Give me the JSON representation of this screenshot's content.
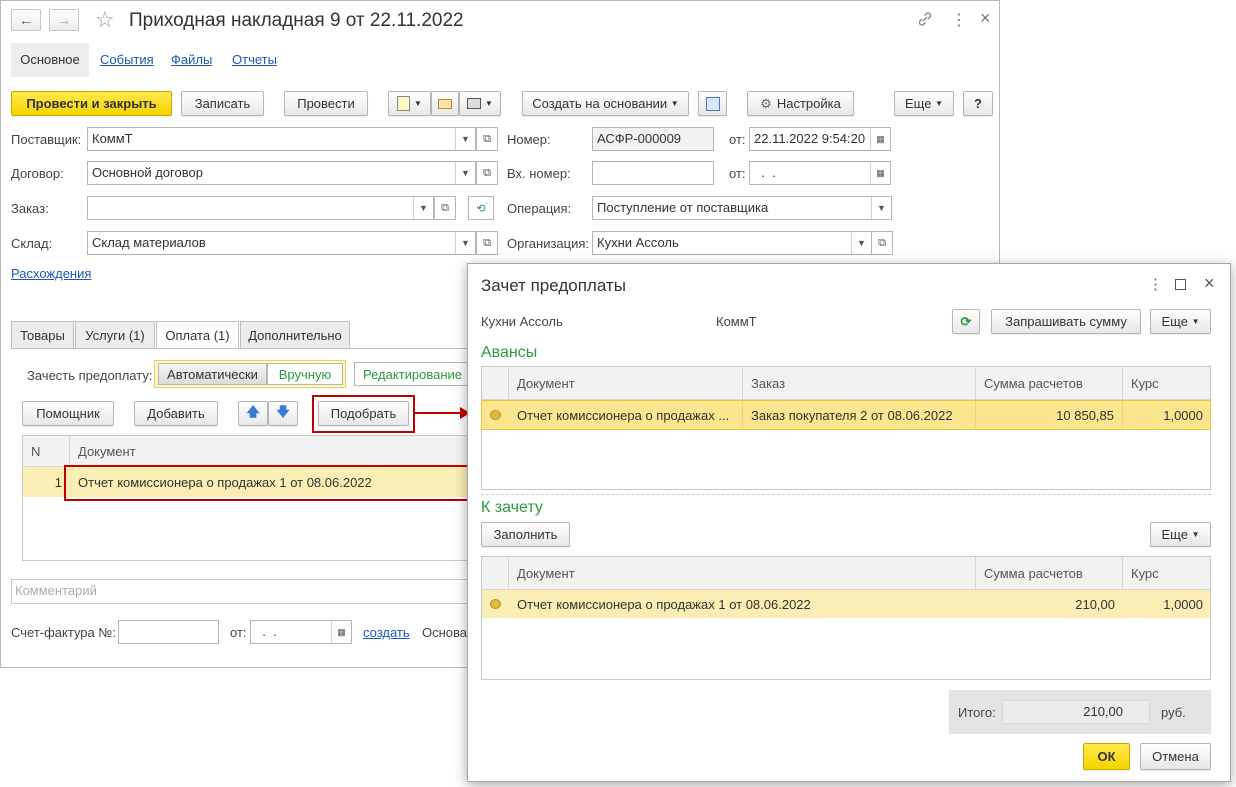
{
  "main": {
    "title": "Приходная накладная 9 от 22.11.2022",
    "nav_back": "←",
    "nav_forward": "→",
    "star": "☆",
    "link_icon": "🔗",
    "more_icon": "⋮",
    "close_icon": "×",
    "tabs": [
      "Основное",
      "События",
      "Файлы",
      "Отчеты"
    ],
    "toolbar": {
      "post_close": "Провести и закрыть",
      "save": "Записать",
      "post": "Провести",
      "create_based": "Создать на основании",
      "settings": "Настройка",
      "more": "Еще",
      "help": "?"
    },
    "fields": {
      "supplier_label": "Поставщик:",
      "supplier_value": "КоммТ",
      "contract_label": "Договор:",
      "contract_value": "Основной договор",
      "order_label": "Заказ:",
      "order_value": "",
      "warehouse_label": "Склад:",
      "warehouse_value": "Склад материалов",
      "number_label": "Номер:",
      "number_value": "АСФР-000009",
      "from_label": "от:",
      "date_value": "22.11.2022  9:54:20",
      "in_number_label": "Вх. номер:",
      "in_number_value": "",
      "in_date_value": "  .  .",
      "operation_label": "Операция:",
      "operation_value": "Поступление от поставщика",
      "org_label": "Организация:",
      "org_value": "Кухни Ассоль"
    },
    "discrepancies_link": "Расхождения",
    "doc_tabs": [
      "Товары",
      "Услуги (1)",
      "Оплата (1)",
      "Дополнительно"
    ],
    "prepay_label": "Зачесть предоплату:",
    "prepay_modes": [
      "Автоматически",
      "Вручную"
    ],
    "edit_mode": "Редактирование",
    "assistant": "Помощник",
    "add": "Добавить",
    "pick": "Подобрать",
    "table_headers": [
      "N",
      "Документ"
    ],
    "table_rows": [
      {
        "n": "1",
        "doc": "Отчет комиссионера о продажах 1 от 08.06.2022"
      }
    ],
    "comment_placeholder": "Комментарий",
    "invoice_label": "Счет-фактура №:",
    "invoice_from": "от:",
    "invoice_date": "  .  .",
    "create_link": "создать",
    "basis_label": "Основа"
  },
  "dialog": {
    "title": "Зачет предоплаты",
    "org": "Кухни Ассоль",
    "counterparty": "КоммТ",
    "ask_sum": "Запрашивать сумму",
    "more": "Еще",
    "advances_title": "Авансы",
    "advances_headers": [
      "Документ",
      "Заказ",
      "Сумма расчетов",
      "Курс"
    ],
    "advances_rows": [
      {
        "doc": "Отчет комиссионера о продажах ...",
        "order": "Заказ покупателя 2 от 08.06.2022",
        "sum": "10 850,85",
        "rate": "1,0000"
      }
    ],
    "offset_title": "К зачету",
    "fill": "Заполнить",
    "offset_headers": [
      "Документ",
      "Сумма расчетов",
      "Курс"
    ],
    "offset_rows": [
      {
        "doc": "Отчет комиссионера о продажах 1 от 08.06.2022",
        "sum": "210,00",
        "rate": "1,0000"
      }
    ],
    "total_label": "Итого:",
    "total_value": "210,00",
    "currency": "руб.",
    "ok": "ОК",
    "cancel": "Отмена"
  },
  "colors": {
    "accent_yellow": "#f5d400",
    "selection": "#fbeeb4",
    "link": "#1c59b3",
    "green": "#2b9a3f",
    "highlight_red": "#c00000"
  }
}
